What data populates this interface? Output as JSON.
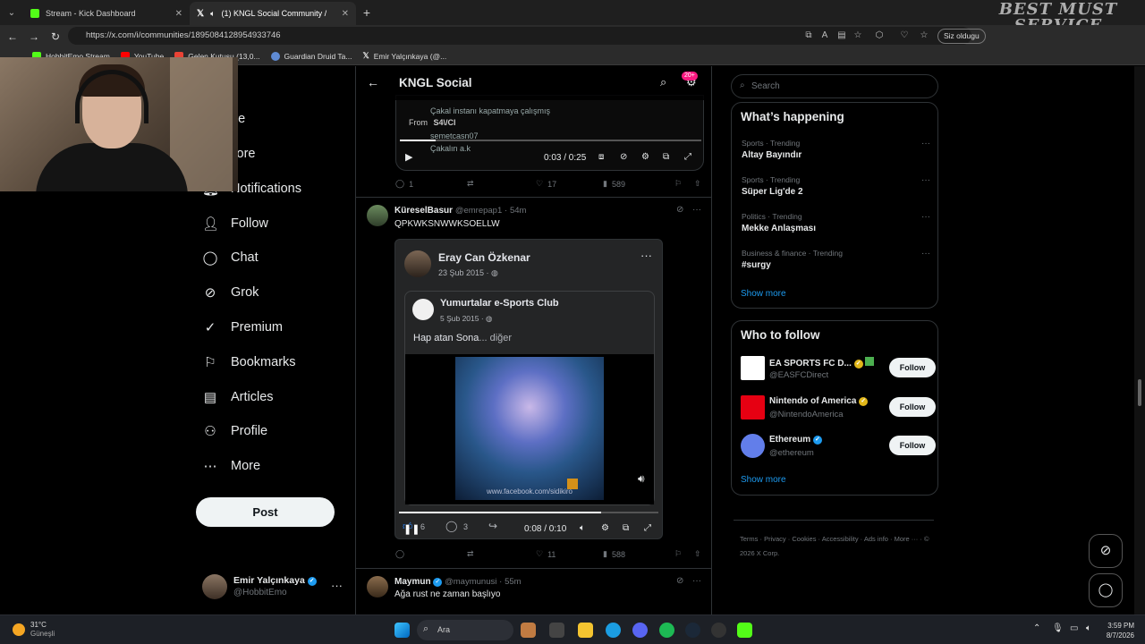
{
  "browser": {
    "tabs": [
      {
        "title": "Stream - Kick Dashboard",
        "active": false,
        "color": "#53fc18"
      },
      {
        "title": "(1) KNGL Social Community /",
        "active": true,
        "color": "#ffffff"
      }
    ],
    "url": "https://x.com/i/communities/1895084128954933746",
    "profile_button": "Siz oldugu",
    "bookmarks": [
      {
        "label": "HobbitEmo Stream",
        "color": "#53fc18"
      },
      {
        "label": "YouTube",
        "color": "#ff0000"
      },
      {
        "label": "Gelen Kutusu (13,0...",
        "color": "#ea4335"
      },
      {
        "label": "Guardian Druid Ta...",
        "color": "#5f8bd4"
      },
      {
        "label": "Emir Yalçınkaya (@...",
        "color": "#ffffff"
      }
    ],
    "watermark": "BEST MUST\nSERVICE"
  },
  "nav": {
    "items": [
      {
        "label": "Home",
        "icon": "home-icon",
        "glyph": "⌂",
        "visible_label": "ome"
      },
      {
        "label": "Explore",
        "icon": "search-icon",
        "glyph": "⌕",
        "visible_label": "xplore"
      },
      {
        "label": "Notifications",
        "icon": "bell-icon",
        "glyph": "🔔︎",
        "visible_label": "Notifications"
      },
      {
        "label": "Follow",
        "icon": "person-add-icon",
        "glyph": "👤︎",
        "visible_label": "Follow"
      },
      {
        "label": "Chat",
        "icon": "chat-icon",
        "glyph": "◯",
        "visible_label": "Chat"
      },
      {
        "label": "Grok",
        "icon": "grok-icon",
        "glyph": "⊘",
        "visible_label": "Grok"
      },
      {
        "label": "Premium",
        "icon": "premium-icon",
        "glyph": "✓",
        "visible_label": "Premium"
      },
      {
        "label": "Bookmarks",
        "icon": "bookmark-icon",
        "glyph": "⚐",
        "visible_label": "Bookmarks"
      },
      {
        "label": "Articles",
        "icon": "articles-icon",
        "glyph": "▤",
        "visible_label": "Articles"
      },
      {
        "label": "Profile",
        "icon": "profile-icon",
        "glyph": "⚇",
        "visible_label": "Profile"
      },
      {
        "label": "More",
        "icon": "more-icon",
        "glyph": "⋯",
        "visible_label": "More"
      }
    ],
    "post_button": "Post",
    "account": {
      "name": "Emir Yalçınkaya",
      "handle": "@HobbitEmo"
    }
  },
  "community": {
    "title": "KNGL Social",
    "badge": "20+",
    "first_post": {
      "video_lines": [
        "Çakal instanı kapatmaya çalışmış",
        "semetcasn07",
        "Çakalın a.k"
      ],
      "from_label": "From",
      "from_source": "S4\\/Cl",
      "time": "0:03 / 0:25",
      "stats": {
        "replies": "1",
        "likes": "17",
        "views": "589"
      }
    },
    "second_post": {
      "author": "KüreselBasur",
      "handle": "@emrepap1",
      "age": "54m",
      "text": "QPKWKSNWWKSOELLW",
      "fb_author": "Eray Can Özkenar",
      "fb_date": "23 Şub 2015",
      "fb_inner_author": "Yumurtalar e-Sports Club",
      "fb_inner_date": "5 Şub 2015",
      "fb_inner_text": "Hap atan Sona",
      "fb_more": "... diğer",
      "fb_watermark": "www.facebook.com/sidikiro",
      "fb_like_count": "6",
      "fb_comment_count": "3",
      "time": "0:08 / 0:10",
      "stats": {
        "replies": "",
        "likes": "11",
        "views": "588"
      }
    },
    "third_post": {
      "author": "Maymun",
      "handle": "@maymunusi",
      "age": "55m",
      "text": "Ağa rust ne zaman başlıyo"
    }
  },
  "sidebar": {
    "search_placeholder": "Search",
    "happening_title": "What’s happening",
    "trends": [
      {
        "category": "Sports · Trending",
        "name": "Altay Bayındır"
      },
      {
        "category": "Sports · Trending",
        "name": "Süper Lig'de 2"
      },
      {
        "category": "Politics · Trending",
        "name": "Mekke Anlaşması"
      },
      {
        "category": "Business & finance · Trending",
        "name": "#surgy"
      }
    ],
    "show_more": "Show more",
    "who_title": "Who to follow",
    "follow_label": "Follow",
    "accounts": [
      {
        "name": "EA SPORTS FC D...",
        "handle": "@EASFCDirect",
        "color": "#ffffff"
      },
      {
        "name": "Nintendo of America",
        "handle": "@NintendoAmerica",
        "color": "#e60012"
      },
      {
        "name": "Ethereum",
        "handle": "@ethereum",
        "color": "#627eea"
      }
    ],
    "footer": [
      "Terms",
      "Privacy",
      "Cookies",
      "Accessibility",
      "Ads info",
      "More ···",
      "© 2026 X Corp."
    ]
  },
  "taskbar": {
    "weather_temp": "31°C",
    "weather_desc": "Güneşli",
    "search_label": "Ara",
    "time": "3:59 PM",
    "date": "8/7/2026"
  }
}
